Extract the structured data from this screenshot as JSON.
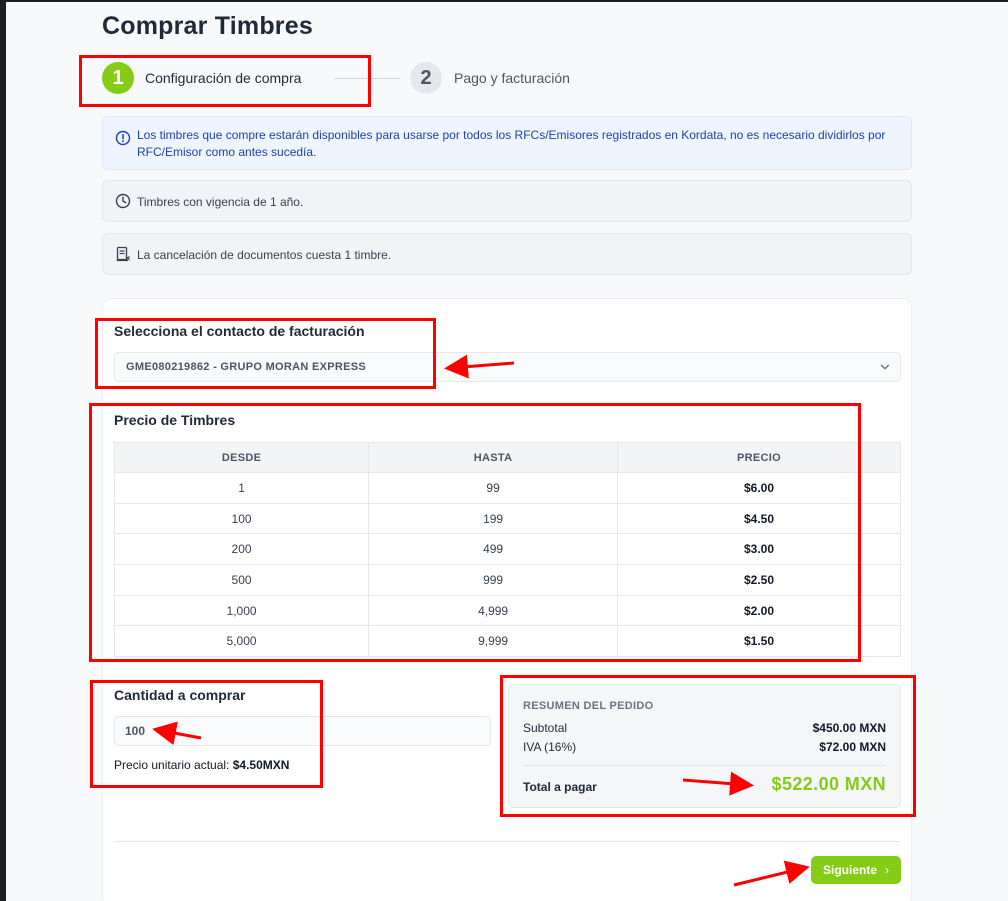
{
  "page": {
    "title": "Comprar Timbres"
  },
  "stepper": {
    "steps": [
      {
        "number": "1",
        "label": "Configuración de compra"
      },
      {
        "number": "2",
        "label": "Pago y facturación"
      }
    ]
  },
  "alerts": {
    "info": "Los timbres que compre estarán disponibles para usarse por todos los RFCs/Emisores registrados en Kordata, no es necesario dividirlos por RFC/Emisor como antes sucedía.",
    "vigencia": "Timbres con vigencia de 1 año.",
    "cancelacion": "La cancelación de documentos cuesta 1 timbre."
  },
  "billing": {
    "title": "Selecciona el contacto de facturación",
    "selected": "GME080219862 - GRUPO MORAN EXPRESS"
  },
  "pricing": {
    "title": "Precio de Timbres",
    "columns": [
      "DESDE",
      "HASTA",
      "PRECIO"
    ],
    "rows": [
      [
        "1",
        "99",
        "$6.00"
      ],
      [
        "100",
        "199",
        "$4.50"
      ],
      [
        "200",
        "499",
        "$3.00"
      ],
      [
        "500",
        "999",
        "$2.50"
      ],
      [
        "1,000",
        "4,999",
        "$2.00"
      ],
      [
        "5,000",
        "9,999",
        "$1.50"
      ]
    ]
  },
  "quantity": {
    "title": "Cantidad a comprar",
    "value": "100",
    "unit_price_label": "Precio unitario actual:",
    "unit_price_value": "$4.50MXN"
  },
  "summary": {
    "title": "RESUMEN DEL PEDIDO",
    "subtotal_label": "Subtotal",
    "subtotal_value": "$450.00 MXN",
    "iva_label": "IVA (16%)",
    "iva_value": "$72.00 MXN",
    "total_label": "Total a pagar",
    "total_value": "$522.00 MXN"
  },
  "actions": {
    "next_label": "Siguiente"
  },
  "colors": {
    "accent": "#84cc16",
    "annotation": "#ff0000",
    "info_text": "#1e40af"
  }
}
